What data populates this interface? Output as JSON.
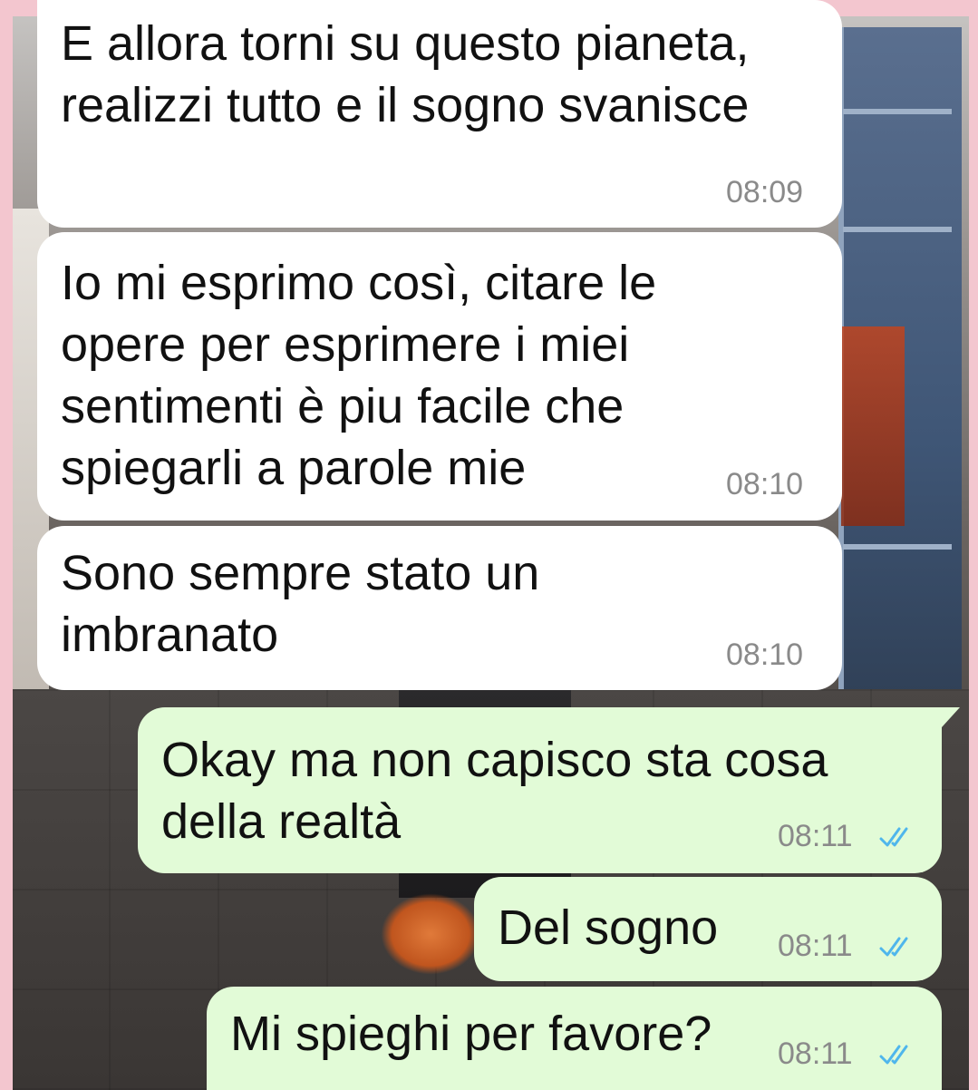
{
  "theme": {
    "incoming_bubble": "#ffffff",
    "outgoing_bubble": "#e2fbd7",
    "timestamp_color": "#8a8a8a",
    "read_tick_color": "#4fb6ec"
  },
  "messages": [
    {
      "direction": "incoming",
      "text": "E allora torni su questo pianeta,\nrealizzi tutto e il sogno svanisce",
      "time": "08:09"
    },
    {
      "direction": "incoming",
      "text": "Io mi esprimo così, citare le\nopere per esprimere i miei\nsentimenti è piu facile che\nspiegarli a parole mie",
      "time": "08:10"
    },
    {
      "direction": "incoming",
      "text": "Sono sempre stato un\nimbranato",
      "time": "08:10"
    },
    {
      "direction": "outgoing",
      "text": "Okay ma non capisco sta cosa\ndella realtà",
      "time": "08:11",
      "status": "read",
      "status_icon": "double-check-icon"
    },
    {
      "direction": "outgoing",
      "text": "Del sogno",
      "time": "08:11",
      "status": "read",
      "status_icon": "double-check-icon"
    },
    {
      "direction": "outgoing",
      "text": "Mi spieghi per favore?",
      "time": "08:11",
      "status": "read",
      "status_icon": "double-check-icon"
    }
  ]
}
